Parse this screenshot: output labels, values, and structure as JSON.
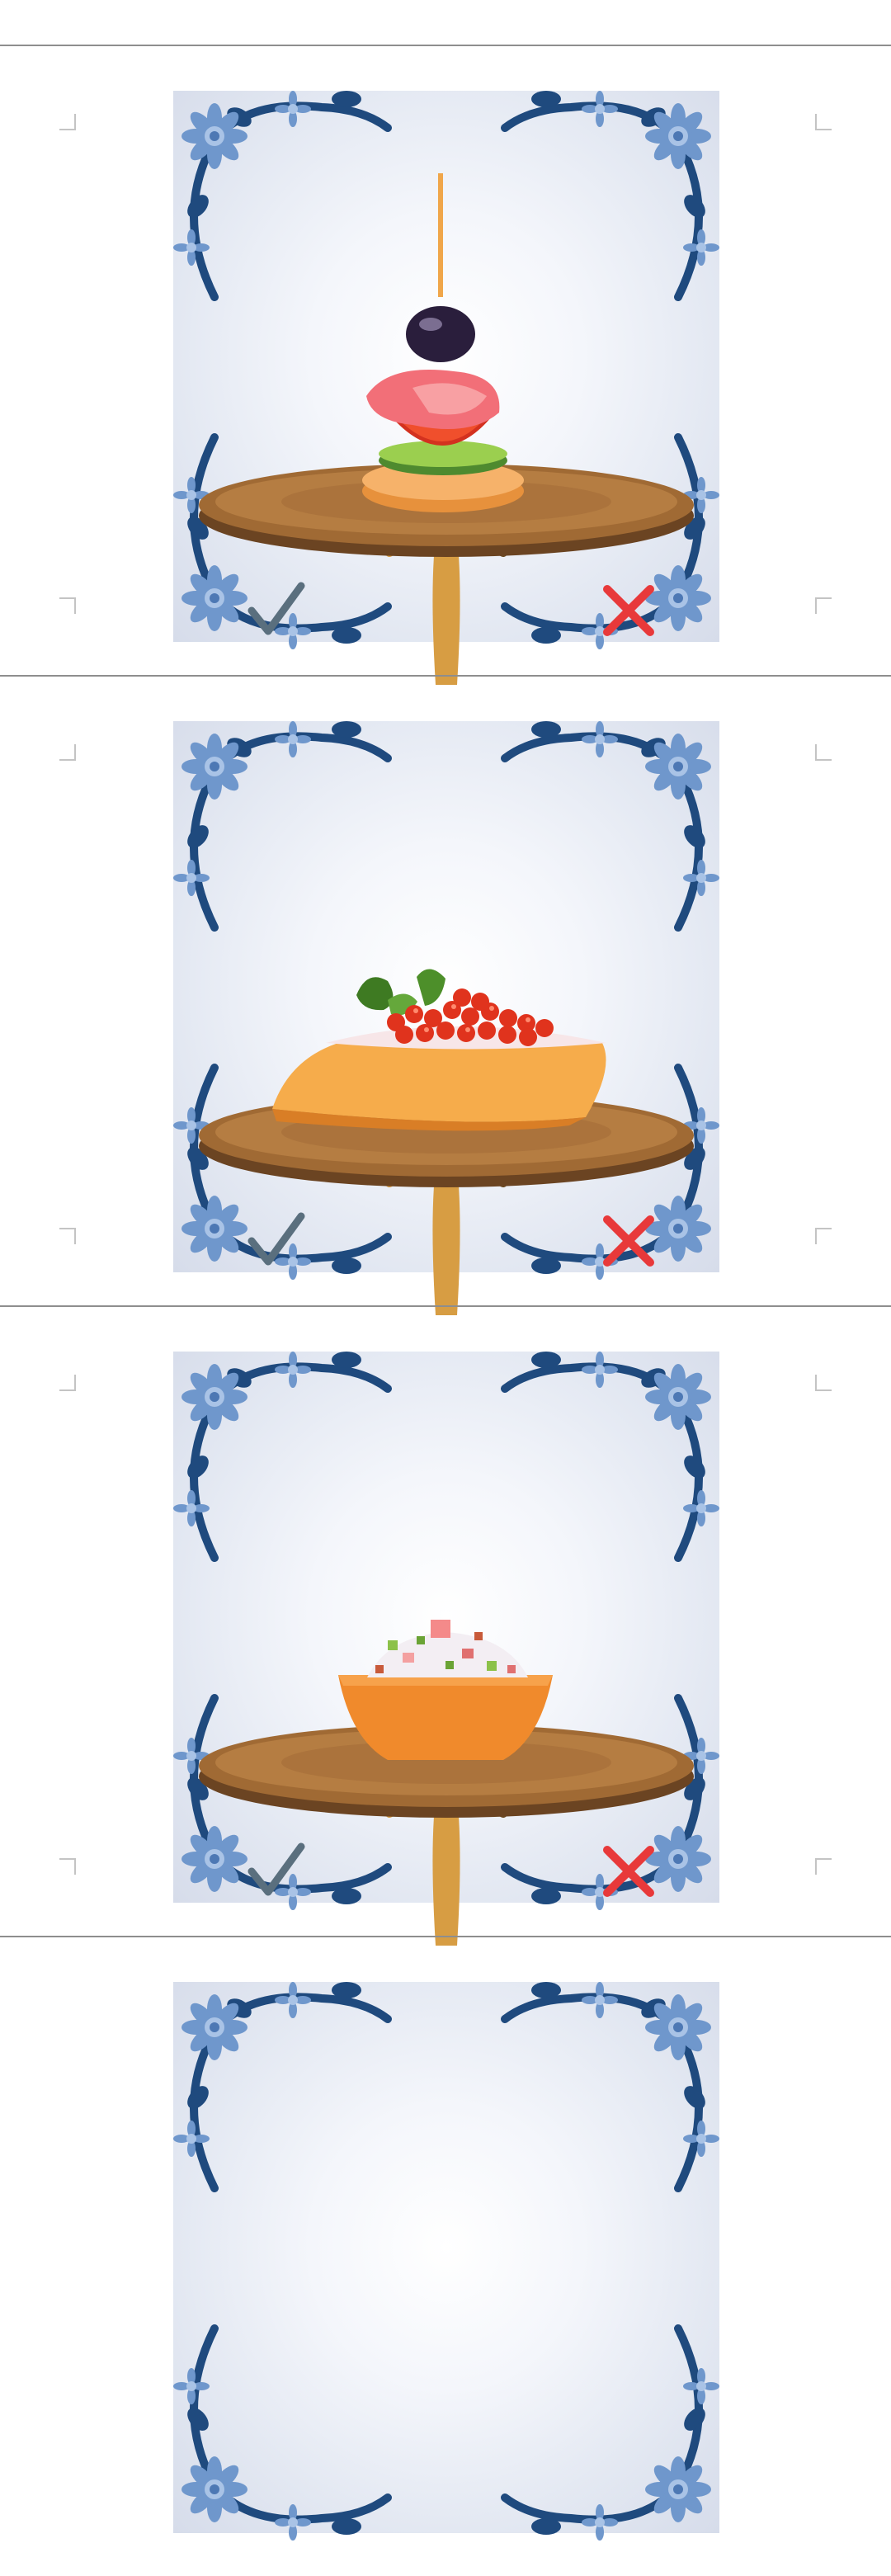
{
  "screen": {
    "items": [
      {
        "food_icon": "canape-olive-salmon-tomato-cucumber-icon",
        "approve_icon": "checkmark-icon",
        "reject_icon": "cross-icon"
      },
      {
        "food_icon": "bruschetta-red-caviar-icon",
        "approve_icon": "checkmark-icon",
        "reject_icon": "cross-icon"
      },
      {
        "food_icon": "tartlet-salad-icon",
        "approve_icon": "checkmark-icon",
        "reject_icon": "cross-icon"
      }
    ]
  },
  "colors": {
    "check": "#5a6f7e",
    "cross": "#e8393a",
    "frame_ornament": "#1f4a7e",
    "flower": "#6f97cc",
    "table_top": "#8a5a2b",
    "divider": "#8e8e8e"
  }
}
